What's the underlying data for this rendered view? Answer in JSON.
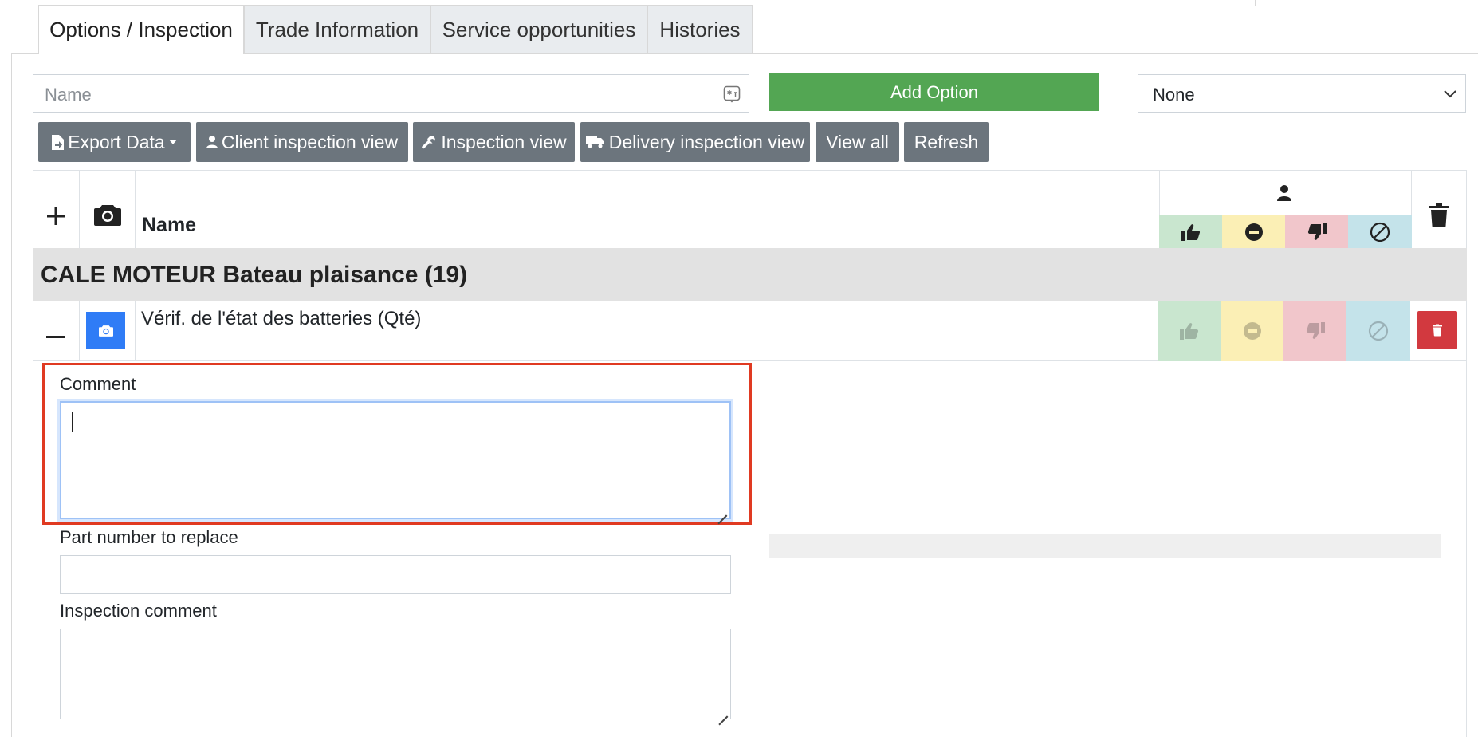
{
  "tabs": [
    {
      "label": "Options / Inspection",
      "active": true
    },
    {
      "label": "Trade Information"
    },
    {
      "label": "Service opportunities"
    },
    {
      "label": "Histories"
    }
  ],
  "toolbar": {
    "name_placeholder": "Name",
    "add_option_label": "Add Option",
    "select_value": "None"
  },
  "buttons": {
    "export": "Export Data",
    "client_view": "Client inspection view",
    "inspection_view": "Inspection view",
    "delivery_view": "Delivery inspection view",
    "view_all": "View all",
    "refresh": "Refresh"
  },
  "table": {
    "name_header": "Name",
    "group_title": "CALE MOTEUR Bateau plaisance (19)",
    "row": {
      "name": "Vérif. de l'état des batteries (Qté)"
    }
  },
  "form": {
    "comment_label": "Comment",
    "comment_value": "",
    "part_number_label": "Part number to replace",
    "part_number_value": "",
    "inspection_comment_label": "Inspection comment",
    "inspection_comment_value": ""
  },
  "colors": {
    "green": "#53a653",
    "good": "#c9e6cf",
    "neutral": "#fbefb5",
    "bad": "#f1c6cb",
    "na": "#c4e3ea",
    "primary": "#2f7cf6",
    "danger": "#d2393f",
    "grey_btn": "#6c757d",
    "group_bg": "#e2e2e2",
    "highlight": "#e03a22"
  }
}
